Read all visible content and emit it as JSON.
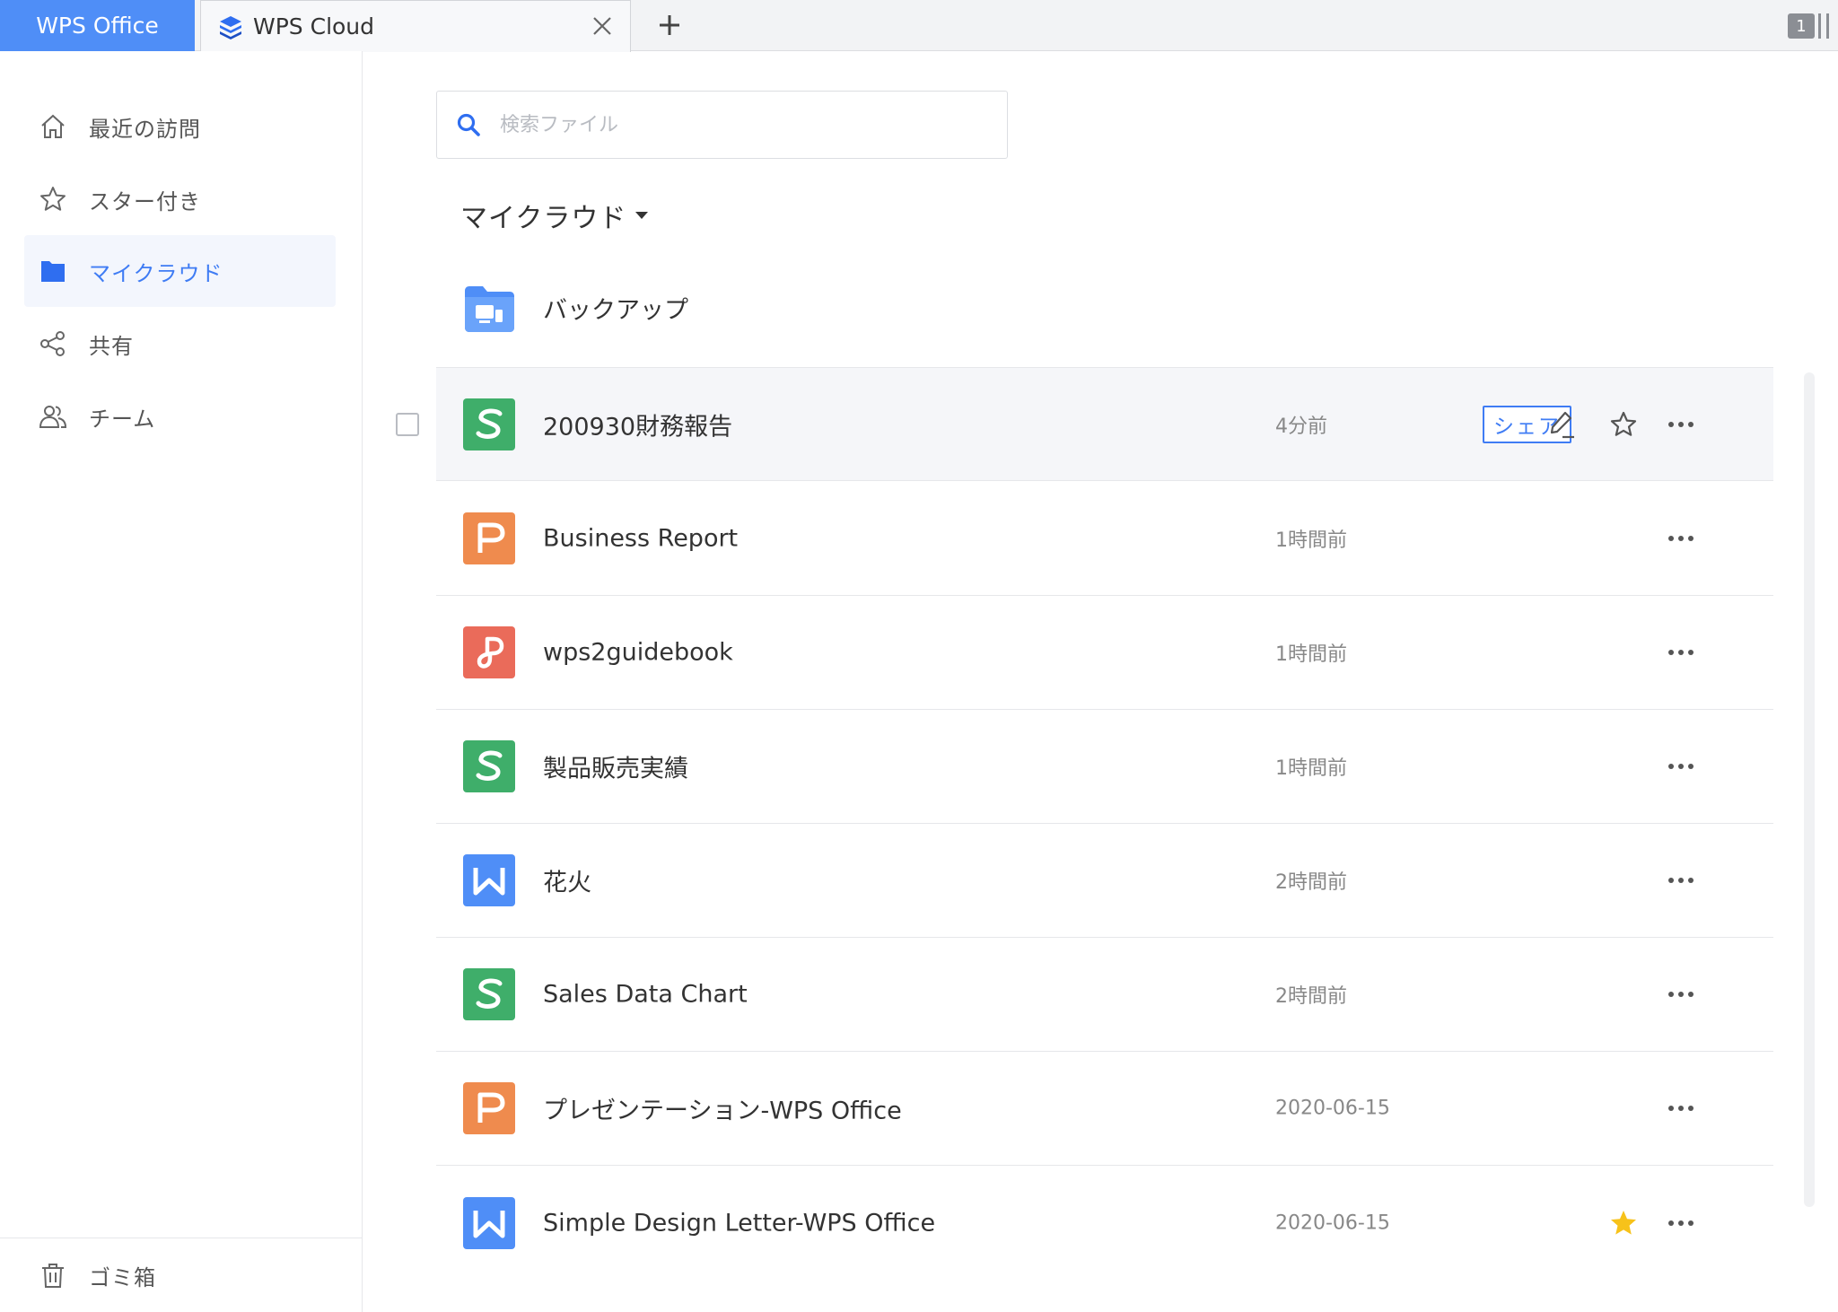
{
  "tabs": {
    "home_label": "WPS Office",
    "cloud_label": "WPS Cloud",
    "window_count": "1"
  },
  "sidebar": {
    "items": [
      {
        "label": "最近の訪問",
        "icon": "home-icon"
      },
      {
        "label": "スター付き",
        "icon": "star-icon"
      },
      {
        "label": "マイクラウド",
        "icon": "folder-icon",
        "active": true
      },
      {
        "label": "共有",
        "icon": "share-icon"
      },
      {
        "label": "チーム",
        "icon": "team-icon"
      }
    ],
    "trash_label": "ゴミ箱"
  },
  "search": {
    "placeholder": "検索ファイル"
  },
  "folder_title": "マイクラウド",
  "files": [
    {
      "name": "バックアップ",
      "time": "",
      "type": "backup-folder"
    },
    {
      "name": "200930財務報告",
      "time": "4分前",
      "type": "spreadsheet",
      "share_label": "シェア",
      "hovered": true
    },
    {
      "name": "Business Report",
      "time": "1時間前",
      "type": "presentation"
    },
    {
      "name": "wps2guidebook",
      "time": "1時間前",
      "type": "pdf"
    },
    {
      "name": "製品販売実績",
      "time": "1時間前",
      "type": "spreadsheet"
    },
    {
      "name": "花火",
      "time": "2時間前",
      "type": "writer"
    },
    {
      "name": "Sales Data Chart",
      "time": "2時間前",
      "type": "spreadsheet"
    },
    {
      "name": "プレゼンテーション-WPS Office",
      "time": "2020-06-15",
      "type": "presentation"
    },
    {
      "name": "Simple Design Letter-WPS Office",
      "time": "2020-06-15",
      "type": "writer",
      "starred": true
    }
  ],
  "colors": {
    "accent": "#3f7cf4",
    "home_tab": "#4f8ef7",
    "spreadsheet": "#3fae6a",
    "presentation": "#ef8b4e",
    "pdf": "#ea6b5a",
    "writer": "#4f8ef7",
    "star": "#f7c21a"
  }
}
